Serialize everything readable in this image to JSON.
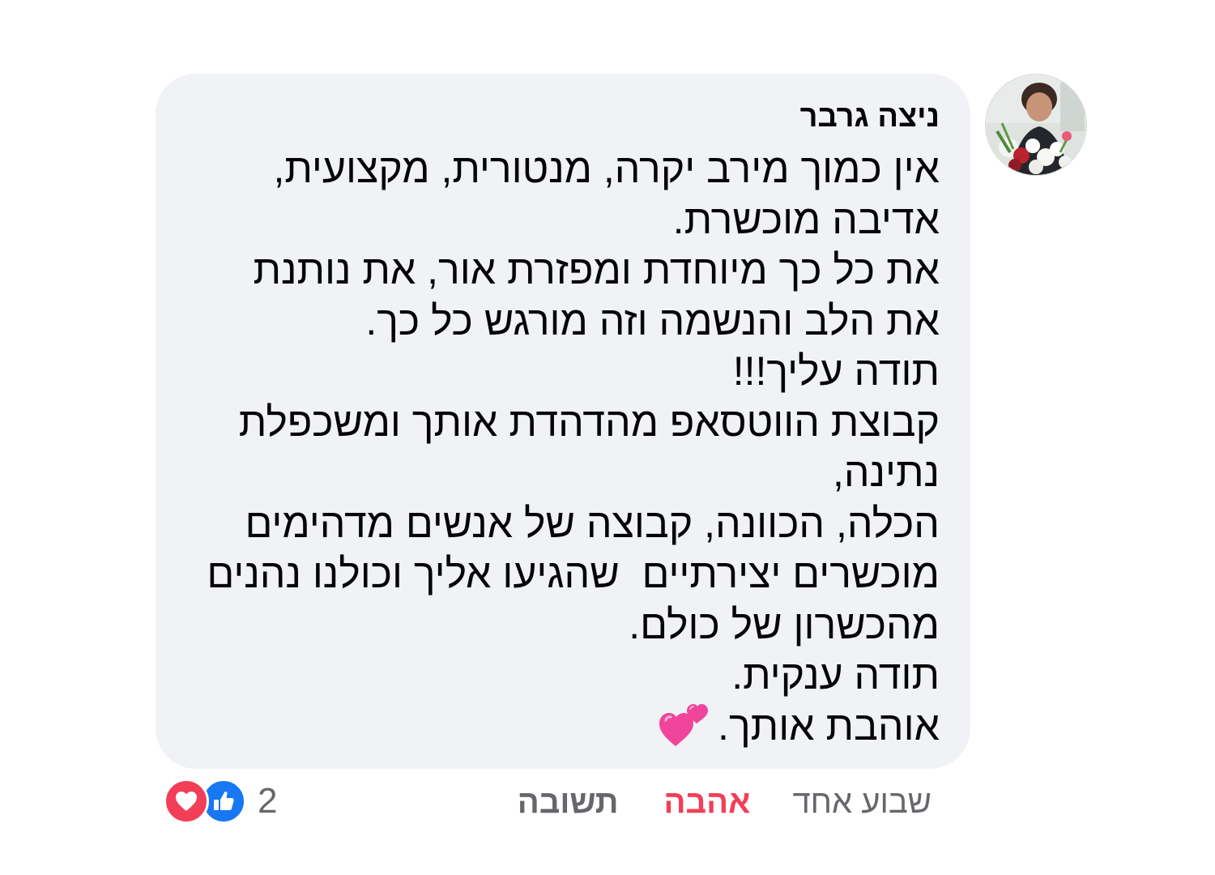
{
  "comment": {
    "author": "ניצה גרבר",
    "avatar_icon": "profile-photo-with-flowers",
    "lines": [
      "אין כמוך מירב יקרה, מנטורית, מקצועית,",
      "אדיבה מוכשרת.",
      "את כל כך מיוחדת ומפזרת אור, את נותנת",
      "את הלב והנשמה וזה מורגש כל כך.",
      "תודה עליך!!!",
      "קבוצת הווטסאפ מהדהדת אותך ומשכפלת",
      "נתינה,",
      "הכלה, הכוונה, קבוצה של אנשים מדהימים",
      "מוכשרים יצירתיים  שהגיעו אליך וכולנו נהנים",
      "מהכשרון של כולם.",
      "תודה ענקית.",
      "אוהבת אותך."
    ],
    "last_line_emoji": "two-hearts-icon"
  },
  "actions": {
    "timestamp": "שבוע אחד",
    "love_label": "אהבה",
    "reply_label": "תשובה"
  },
  "reactions": {
    "count": "2",
    "icons": [
      "heart-reaction-icon",
      "like-reaction-icon"
    ]
  },
  "colors": {
    "bubble": "#f0f2f5",
    "love": "#f33e58",
    "like": "#1877f2",
    "secondary_text": "#65676b",
    "text": "#050505"
  }
}
